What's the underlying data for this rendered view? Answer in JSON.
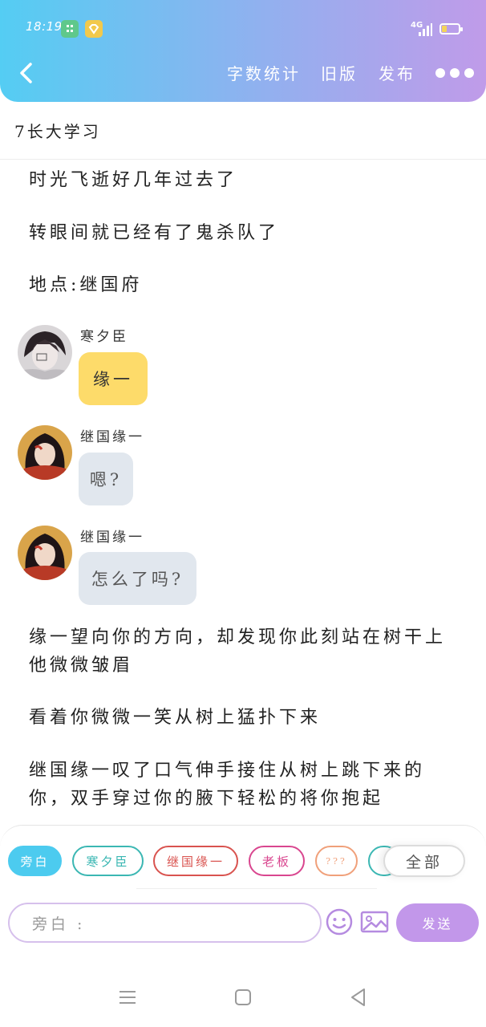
{
  "status_bar": {
    "time": "18:19",
    "network": "4G"
  },
  "nav": {
    "count_label": "字数统计",
    "old_label": "旧版",
    "publish_label": "发布"
  },
  "title": "7长大学习",
  "story": {
    "para1": "时光飞逝好几年过去了",
    "para2": "转眼间就已经有了鬼杀队了",
    "para3": "地点:继国府",
    "para4": [
      "缘一望向你的方向，却发现你此刻站在树干上",
      "他微微皱眉"
    ],
    "para5": "看着你微微一笑从树上猛扑下来",
    "para6": [
      "继国缘一叹了口气伸手接住从树上跳下来的",
      "你，双手穿过你的腋下轻松的将你抱起"
    ]
  },
  "messages": [
    {
      "speaker": "寒夕臣",
      "text": "缘一",
      "avatar": "avatar-hanxichen"
    },
    {
      "speaker": "继国缘一",
      "text": "嗯?",
      "avatar": "avatar-yoriichi"
    },
    {
      "speaker": "继国缘一",
      "text": "怎么了吗?",
      "avatar": "avatar-yoriichi"
    }
  ],
  "roles": [
    {
      "label": "旁白",
      "color": "#4ccbef"
    },
    {
      "label": "寒夕臣",
      "color": "#3bb7b3"
    },
    {
      "label": "继国缘一",
      "color": "#d9534f"
    },
    {
      "label": "老板",
      "color": "#d9468f"
    },
    {
      "label": "???",
      "color": "#f0a07a"
    },
    {
      "label": "",
      "color": "#3bb7b3"
    }
  ],
  "all_label": "全部",
  "input": {
    "placeholder": "旁白 :"
  },
  "send_label": "发送",
  "colors": {
    "header_start": "#54cdf3",
    "header_end": "#c09be9",
    "send": "#c297ea",
    "bubble_yellow": "#fddb6a",
    "bubble_gray": "#e1e7ee"
  }
}
